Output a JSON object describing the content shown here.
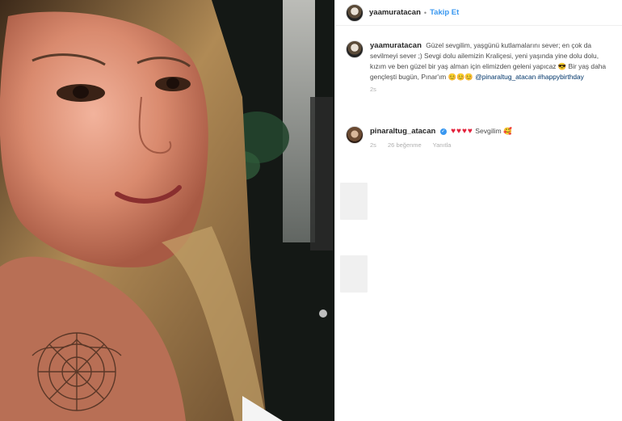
{
  "post": {
    "author": "yaamuratacan",
    "follow_label": "Takip Et",
    "caption_user": "yaamuratacan",
    "caption_text": "Güzel sevgilim, yaşgünü kutlamalarını sever; en çok da sevilmeyi sever ;) Sevgi dolu ailemizin Kraliçesi, yeni yaşında yine dolu dolu, kızım ve ben güzel bir yaş alman için elimizden geleni yapıcaz 😎 Bir yaş daha gençleşti bugün, Pınar'ım 😊😊😊",
    "caption_tags": "@pinaraltug_atacan #happybirthday",
    "caption_time": "2s"
  },
  "comment": {
    "user": "pinaraltug_atacan",
    "hearts": "♥♥♥♥",
    "text": "Sevgilim",
    "emoji": "🥰",
    "time": "2s",
    "likes": "26 beğenme",
    "reply": "Yanıtla"
  },
  "colors": {
    "link": "#3897f0",
    "hashtag": "#003569",
    "heart": "#e3213b"
  },
  "icons": {
    "author_avatar": "profile-avatar",
    "commenter_avatar": "profile-avatar",
    "verified_badge": "verified-badge-icon"
  }
}
